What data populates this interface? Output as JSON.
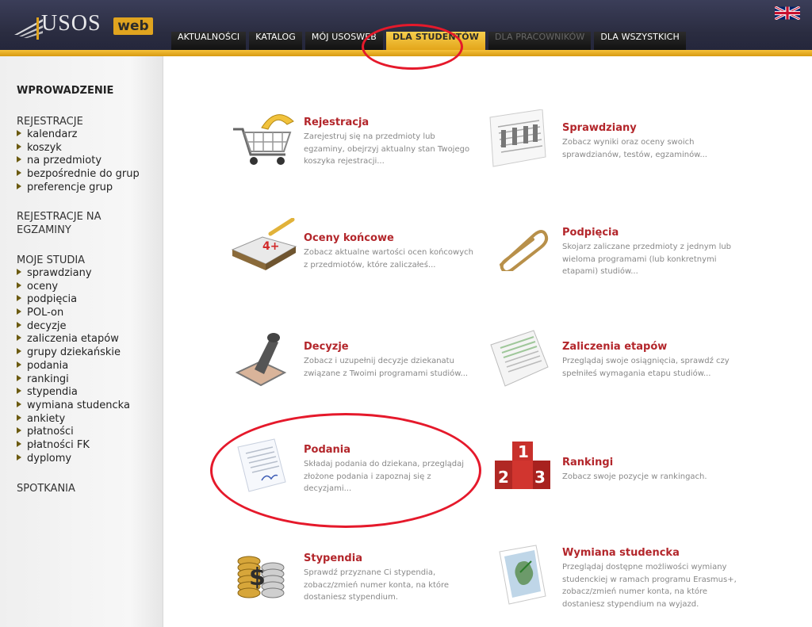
{
  "header": {
    "logo_text": "USOS",
    "logo_badge": "web",
    "tabs": [
      {
        "label": "AKTUALNOŚCI"
      },
      {
        "label": "KATALOG"
      },
      {
        "label": "MÓJ USOSWEB"
      },
      {
        "label": "DLA STUDENTÓW"
      },
      {
        "label": "DLA PRACOWNIKÓW"
      },
      {
        "label": "DLA WSZYSTKICH"
      }
    ]
  },
  "sidebar": {
    "heading": "WPROWADZENIE",
    "sections": [
      {
        "label": "REJESTRACJE",
        "items": [
          "kalendarz",
          "koszyk",
          "na przedmioty",
          "bezpośrednie do grup",
          "preferencje grup"
        ]
      },
      {
        "label": "REJESTRACJE NA EGZAMINY",
        "items": []
      },
      {
        "label": "MOJE STUDIA",
        "items": [
          "sprawdziany",
          "oceny",
          "podpięcia",
          "POL-on",
          "decyzje",
          "zaliczenia etapów",
          "grupy dziekańskie",
          "podania",
          "rankingi",
          "stypendia",
          "wymiana studencka",
          "ankiety",
          "płatności",
          "płatności FK",
          "dyplomy"
        ]
      },
      {
        "label": "SPOTKANIA",
        "items": []
      }
    ]
  },
  "cards": [
    {
      "title": "Rejestracja",
      "desc": "Zarejestruj się na przedmioty lub egzaminy, obejrzyj aktualny stan Twojego koszyka rejestracji...",
      "icon": "shopping-cart-icon"
    },
    {
      "title": "Sprawdziany",
      "desc": "Zobacz wyniki oraz oceny swoich sprawdzianów, testów, egzaminów...",
      "icon": "grade-sheet-icon"
    },
    {
      "title": "Oceny końcowe",
      "desc": "Zobacz aktualne wartości ocen końcowych z przedmiotów, które zaliczałeś...",
      "icon": "gradebook-icon",
      "grade": "4+"
    },
    {
      "title": "Podpięcia",
      "desc": "Skojarz zaliczane przedmioty z jednym lub wieloma programami (lub konkretnymi etapami) studiów...",
      "icon": "paperclip-icon"
    },
    {
      "title": "Decyzje",
      "desc": "Zobacz i uzupełnij decyzje dziekanatu związane z Twoimi programami studiów...",
      "icon": "stamp-icon"
    },
    {
      "title": "Zaliczenia etapów",
      "desc": "Przeglądaj swoje osiągnięcia, sprawdź czy spełniłeś wymagania etapu studiów...",
      "icon": "checklist-icon"
    },
    {
      "title": "Podania",
      "desc": "Składaj podania do dziekana, przeglądaj złożone podania i zapoznaj się z decyzjami...",
      "icon": "document-icon"
    },
    {
      "title": "Rankingi",
      "desc": "Zobacz swoje pozycje w rankingach.",
      "icon": "podium-icon"
    },
    {
      "title": "Stypendia",
      "desc": "Sprawdź przyznane Ci stypendia, zobacz/zmień numer konta, na które dostaniesz stypendium.",
      "icon": "coins-icon"
    },
    {
      "title": "Wymiana studencka",
      "desc": "Przeglądaj dostępne możliwości wymiany studenckiej w ramach programu Erasmus+, zobacz/zmień numer konta, na które dostaniesz stypendium na wyjazd.",
      "icon": "map-icon"
    }
  ],
  "colors": {
    "accent": "#e3a51a",
    "title": "#b3262b",
    "highlight": "#e5192b"
  }
}
